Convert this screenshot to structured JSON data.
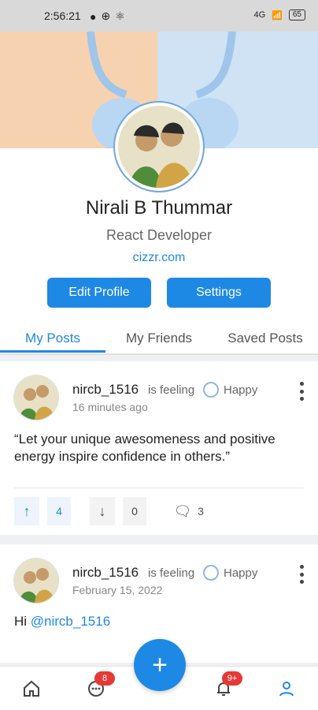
{
  "status_bar": {
    "time": "2:56:21",
    "battery": "65",
    "network": "4G"
  },
  "profile": {
    "name": "Nirali B Thummar",
    "role": "React Developer",
    "website": "cizzr.com",
    "edit_button": "Edit Profile",
    "settings_button": "Settings"
  },
  "tabs": [
    {
      "label": "My Posts",
      "active": true
    },
    {
      "label": "My Friends"
    },
    {
      "label": "Saved Posts"
    }
  ],
  "posts": [
    {
      "username": "nircb_1516",
      "feeling_label": "is feeling",
      "mood": "Happy",
      "time": "16 minutes ago",
      "text": "“Let your unique awesomeness and positive energy inspire confidence in others.”",
      "upvotes": "4",
      "downvotes": "0",
      "comments": "3"
    },
    {
      "username": "nircb_1516",
      "feeling_label": "is feeling",
      "mood": "Happy",
      "time": "February 15, 2022",
      "text_prefix": "Hi ",
      "mention": "@nircb_1516"
    }
  ],
  "bottom_nav": {
    "chat_badge": "8",
    "notification_badge": "9+"
  },
  "colors": {
    "accent": "#1e88e5",
    "badge": "#e53935"
  }
}
